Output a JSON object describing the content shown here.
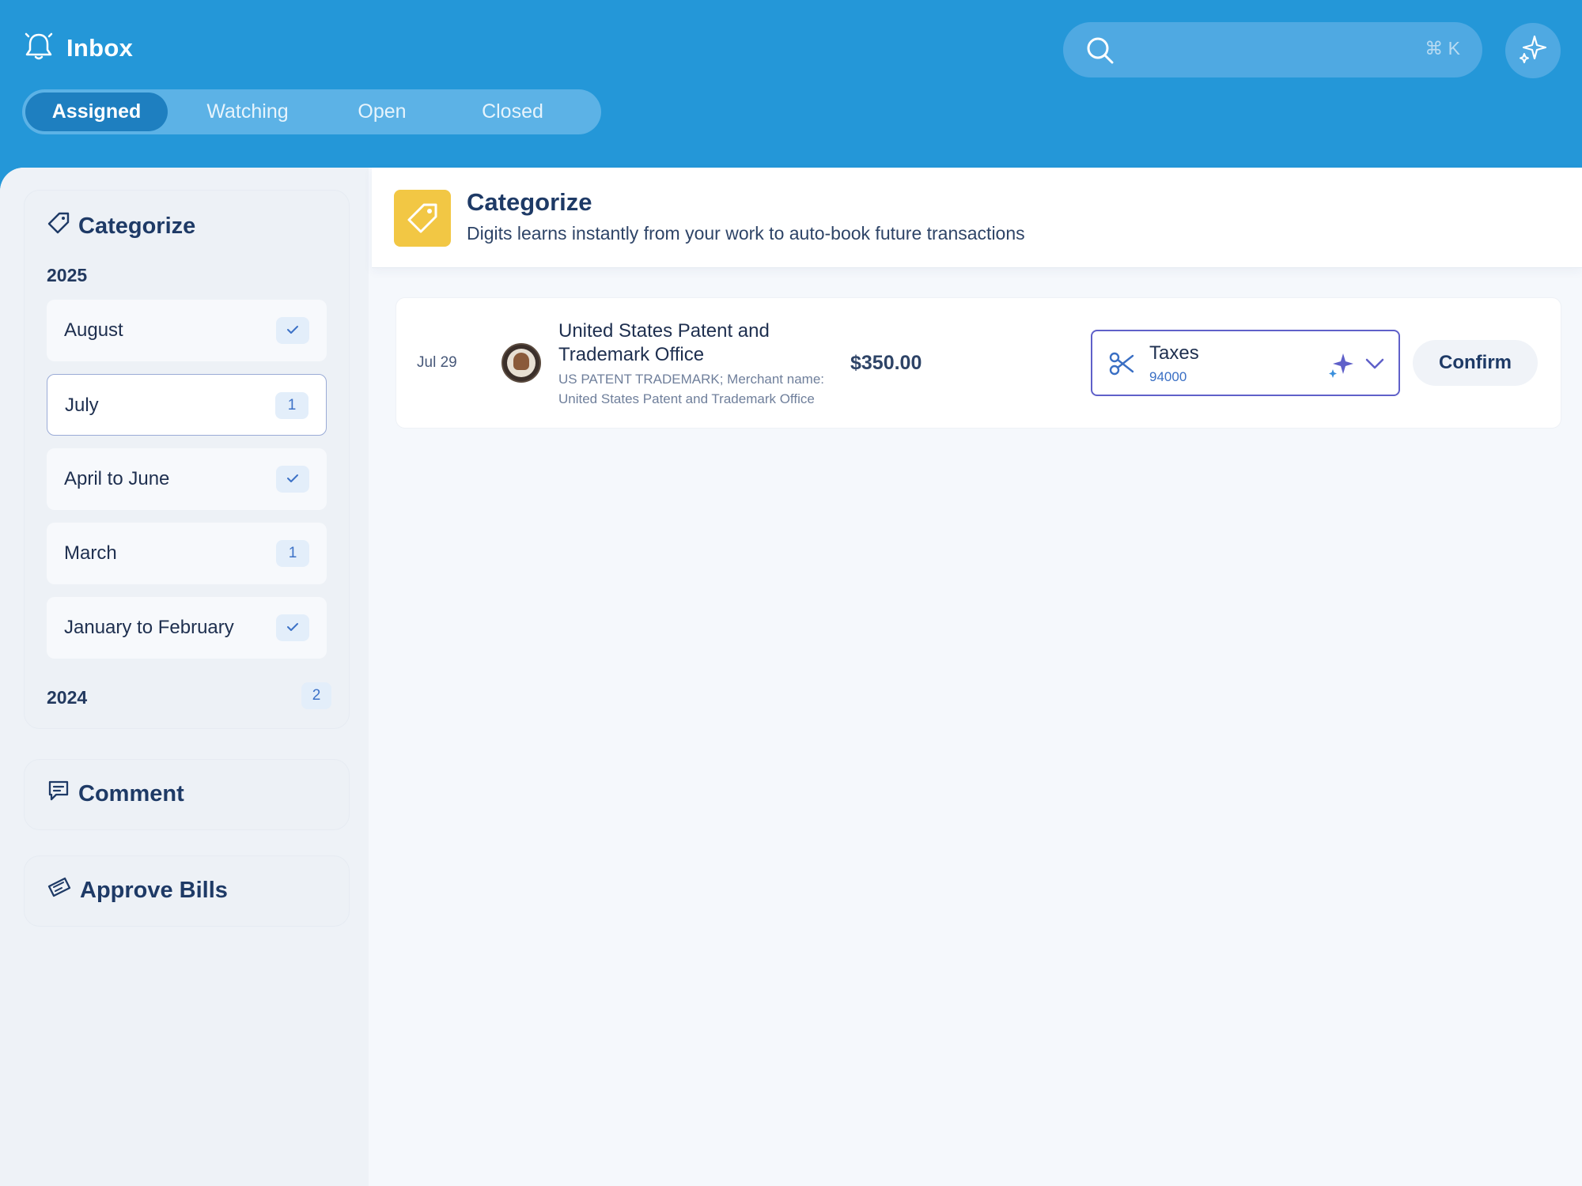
{
  "header": {
    "title": "Inbox",
    "tabs": [
      {
        "label": "Assigned",
        "active": true
      },
      {
        "label": "Watching",
        "active": false
      },
      {
        "label": "Open",
        "active": false
      },
      {
        "label": "Closed",
        "active": false
      }
    ],
    "search": {
      "placeholder": "",
      "shortcut": "⌘ K"
    }
  },
  "sidebar": {
    "categorize": {
      "title": "Categorize",
      "year_2025": "2025",
      "periods": [
        {
          "label": "August",
          "badge": "",
          "done": true
        },
        {
          "label": "July",
          "badge": "1",
          "done": false,
          "selected": true
        },
        {
          "label": "April to June",
          "badge": "",
          "done": true
        },
        {
          "label": "March",
          "badge": "1",
          "done": false
        },
        {
          "label": "January to February",
          "badge": "",
          "done": true
        }
      ],
      "year_2024": "2024",
      "year_2024_count": "2"
    },
    "comment": {
      "title": "Comment"
    },
    "approve_bills": {
      "title": "Approve Bills"
    }
  },
  "content": {
    "title": "Categorize",
    "subtitle": "Digits learns instantly from your work to auto-book future transactions",
    "transaction": {
      "date": "Jul 29",
      "name": "United States Patent and Trademark Office",
      "description": "US PATENT TRADEMARK; Merchant name: United States Patent and Trademark Office",
      "amount": "$350.00",
      "category": {
        "name": "Taxes",
        "code": "94000"
      },
      "confirm_label": "Confirm"
    }
  },
  "colors": {
    "header_bg": "#2497d8",
    "accent_yellow": "#f2c744",
    "select_border": "#5f60c9",
    "text_dark": "#1e3a66"
  }
}
